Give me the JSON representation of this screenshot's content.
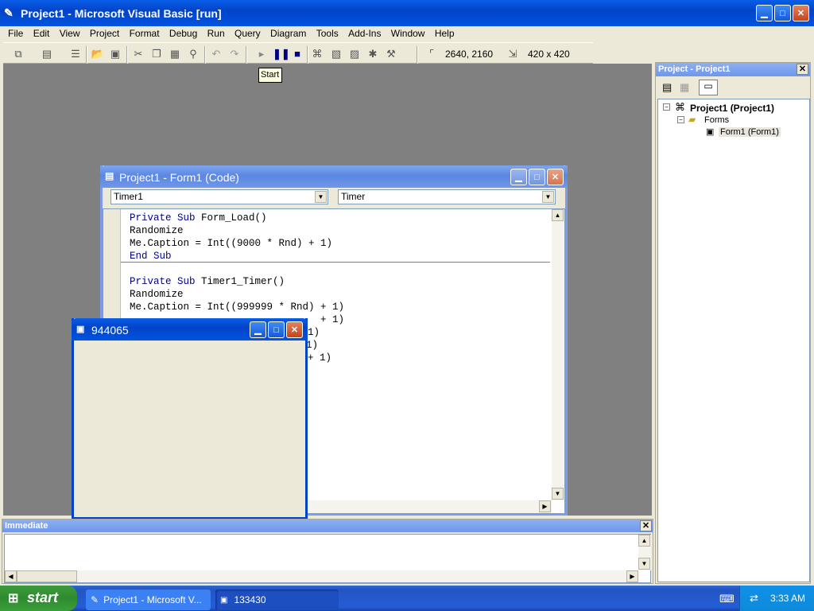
{
  "app": {
    "title": "Project1 - Microsoft Visual Basic [run]"
  },
  "menu": [
    "File",
    "Edit",
    "View",
    "Project",
    "Format",
    "Debug",
    "Run",
    "Query",
    "Diagram",
    "Tools",
    "Add-Ins",
    "Window",
    "Help"
  ],
  "toolbar": {
    "position": "2640, 2160",
    "size": "420 x 420",
    "tooltip": "Start"
  },
  "code_window": {
    "title": "Project1 - Form1 (Code)",
    "object_combo": "Timer1",
    "proc_combo": "Timer",
    "lines": [
      "Private Sub Form_Load()",
      "Randomize",
      "Me.Caption = Int((9000 * Rnd) + 1)",
      "End Sub",
      "",
      "Private Sub Timer1_Timer()",
      "Randomize",
      "Me.Caption = Int((999999 * Rnd) + 1)",
      "+ 1)",
      "1)",
      "1)",
      "+ 1)"
    ]
  },
  "running_form": {
    "title": "944065"
  },
  "project_explorer": {
    "title": "Project - Project1",
    "root": "Project1 (Project1)",
    "folder": "Forms",
    "item": "Form1 (Form1)"
  },
  "immediate": {
    "title": "Immediate"
  },
  "taskbar": {
    "start": "start",
    "tasks": [
      "Project1 - Microsoft V...",
      "133430"
    ],
    "clock": "3:33 AM"
  }
}
